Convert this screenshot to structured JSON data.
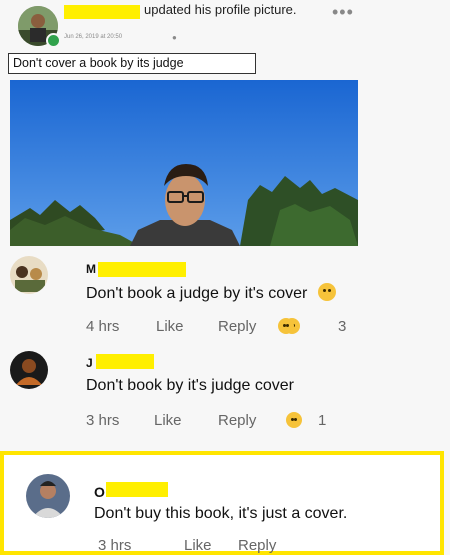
{
  "post": {
    "header_text": "updated his profile picture.",
    "timestamp": "Jun 26, 2019 at 20:50",
    "caption": "Don't cover a book by its judge"
  },
  "comments": [
    {
      "initial": "M",
      "text": "Don't book a judge by it's cover",
      "time": "4 hrs",
      "like_label": "Like",
      "reply_label": "Reply",
      "reaction_count": "3"
    },
    {
      "initial": "J",
      "text": "Don't book by it's judge cover",
      "time": "3 hrs",
      "like_label": "Like",
      "reply_label": "Reply",
      "reaction_count": "1"
    },
    {
      "initial": "O",
      "text": "Don't buy this book, it's just a cover.",
      "time": "3 hrs",
      "like_label": "Like",
      "reply_label": "Reply"
    }
  ],
  "icons": {
    "more": "more-options-icon",
    "globe": "globe-icon",
    "reaction": "reaction-emoji-icon"
  },
  "colors": {
    "redaction": "#ffef00",
    "highlight_border": "#ffe500",
    "online": "#31a24c"
  }
}
